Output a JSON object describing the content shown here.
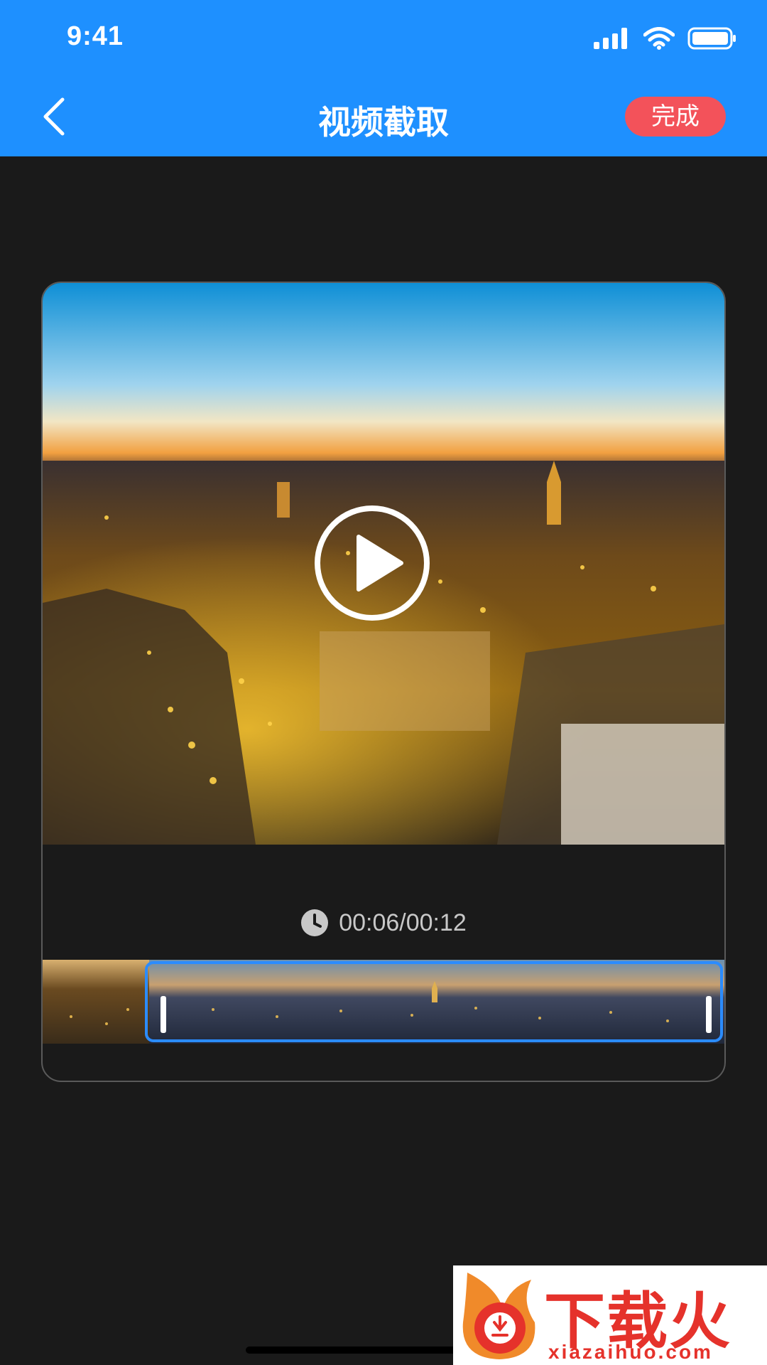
{
  "status_bar": {
    "time": "9:41"
  },
  "nav": {
    "title": "视频截取",
    "done_label": "完成"
  },
  "player": {
    "timecode": "00:06/00:12"
  },
  "watermark": {
    "text": "下载火",
    "url": "xiazaihuo.com"
  },
  "colors": {
    "accent": "#1e90ff",
    "done": "#f3525a",
    "selection": "#2b8cff",
    "background": "#1a1a1a"
  }
}
